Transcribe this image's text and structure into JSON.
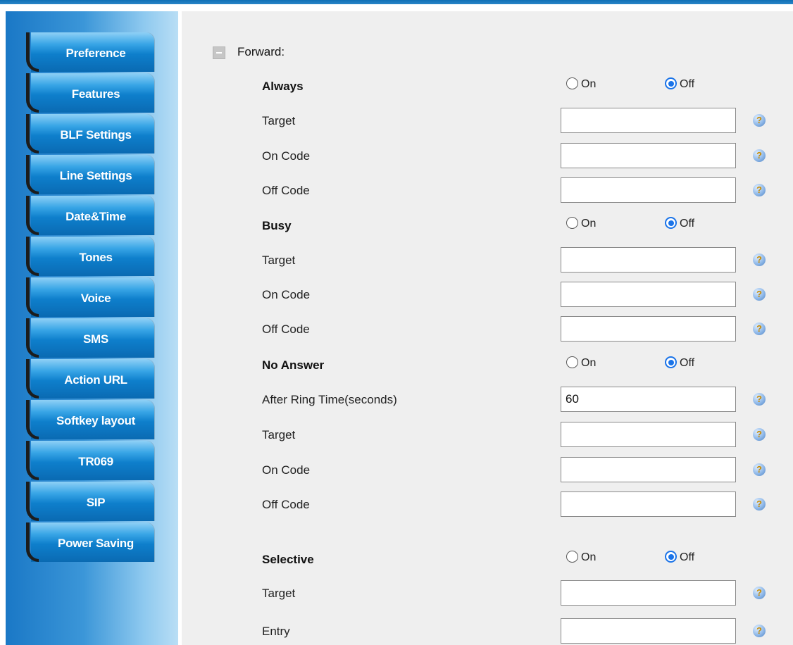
{
  "sidebar": {
    "items": [
      {
        "label": "Preference"
      },
      {
        "label": "Features"
      },
      {
        "label": "BLF Settings"
      },
      {
        "label": "Line Settings"
      },
      {
        "label": "Date&Time"
      },
      {
        "label": "Tones"
      },
      {
        "label": "Voice"
      },
      {
        "label": "SMS"
      },
      {
        "label": "Action URL"
      },
      {
        "label": "Softkey layout"
      },
      {
        "label": "TR069"
      },
      {
        "label": "SIP"
      },
      {
        "label": "Power Saving"
      }
    ]
  },
  "forward": {
    "title": "Forward:",
    "on_label": "On",
    "off_label": "Off",
    "help_glyph": "?",
    "always": {
      "label": "Always",
      "selected": "Off",
      "target": {
        "label": "Target",
        "value": ""
      },
      "on_code": {
        "label": "On Code",
        "value": ""
      },
      "off_code": {
        "label": "Off Code",
        "value": ""
      }
    },
    "busy": {
      "label": "Busy",
      "selected": "Off",
      "target": {
        "label": "Target",
        "value": ""
      },
      "on_code": {
        "label": "On Code",
        "value": ""
      },
      "off_code": {
        "label": "Off Code",
        "value": ""
      }
    },
    "no_answer": {
      "label": "No Answer",
      "selected": "Off",
      "after_ring_time": {
        "label": "After Ring Time(seconds)",
        "value": "60"
      },
      "target": {
        "label": "Target",
        "value": ""
      },
      "on_code": {
        "label": "On Code",
        "value": ""
      },
      "off_code": {
        "label": "Off Code",
        "value": ""
      }
    },
    "selective": {
      "label": "Selective",
      "selected": "Off",
      "target": {
        "label": "Target",
        "value": ""
      },
      "entry": {
        "label": "Entry",
        "value": ""
      }
    }
  },
  "colors": {
    "accent": "#1a73e8",
    "sidebar_tab": "#0e7fcc",
    "content_bg": "#efefef",
    "topbar": "#0f6fb5"
  },
  "icons": {
    "collapse": "minus-square-icon",
    "help": "help-icon",
    "radio": "radio-icon"
  }
}
